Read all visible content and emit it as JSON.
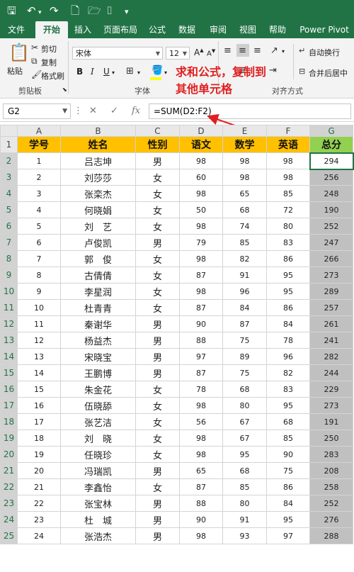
{
  "quick_access": {
    "save_icon": "save-icon",
    "undo_icon": "undo-icon",
    "redo_icon": "redo-icon",
    "new_icon": "new-file-icon",
    "open_icon": "open-folder-icon",
    "camera_icon": "camera-icon"
  },
  "tabs": [
    "文件",
    "开始",
    "插入",
    "页面布局",
    "公式",
    "数据",
    "审阅",
    "视图",
    "帮助",
    "Power Pivot"
  ],
  "active_tab": "开始",
  "clipboard": {
    "paste": "粘贴",
    "cut": "剪切",
    "copy": "复制",
    "format_painter": "格式刷",
    "group": "剪贴板"
  },
  "font": {
    "name": "宋体",
    "size": "12",
    "group": "字体",
    "bold": "B",
    "italic": "I",
    "underline": "U"
  },
  "alignment": {
    "wrap": "自动换行",
    "merge": "合并后居中",
    "group": "对齐方式"
  },
  "formula_bar": {
    "name_box": "G2",
    "formula": "=SUM(D2:F2)",
    "fx": "fx"
  },
  "annotation": {
    "line1": "求和公式，复制到",
    "line2": "其他单元格"
  },
  "columns": [
    "A",
    "B",
    "C",
    "D",
    "E",
    "F",
    "G"
  ],
  "headers": [
    "学号",
    "姓名",
    "性别",
    "语文",
    "数学",
    "英语",
    "总分"
  ],
  "rows": [
    [
      "1",
      "吕志坤",
      "男",
      "98",
      "98",
      "98",
      "294"
    ],
    [
      "2",
      "刘莎莎",
      "女",
      "60",
      "98",
      "98",
      "256"
    ],
    [
      "3",
      "张栾杰",
      "女",
      "98",
      "65",
      "85",
      "248"
    ],
    [
      "4",
      "何晓娟",
      "女",
      "50",
      "68",
      "72",
      "190"
    ],
    [
      "5",
      "刘　艺",
      "女",
      "98",
      "74",
      "80",
      "252"
    ],
    [
      "6",
      "卢俊凯",
      "男",
      "79",
      "85",
      "83",
      "247"
    ],
    [
      "7",
      "郭　俊",
      "女",
      "98",
      "82",
      "86",
      "266"
    ],
    [
      "8",
      "古倩倩",
      "女",
      "87",
      "91",
      "95",
      "273"
    ],
    [
      "9",
      "李星润",
      "女",
      "98",
      "96",
      "95",
      "289"
    ],
    [
      "10",
      "杜青青",
      "女",
      "87",
      "84",
      "86",
      "257"
    ],
    [
      "11",
      "秦谢华",
      "男",
      "90",
      "87",
      "84",
      "261"
    ],
    [
      "12",
      "杨益杰",
      "男",
      "88",
      "75",
      "78",
      "241"
    ],
    [
      "13",
      "宋晓宝",
      "男",
      "97",
      "89",
      "96",
      "282"
    ],
    [
      "14",
      "王鹏博",
      "男",
      "87",
      "75",
      "82",
      "244"
    ],
    [
      "15",
      "朱金花",
      "女",
      "78",
      "68",
      "83",
      "229"
    ],
    [
      "16",
      "伍晓舔",
      "女",
      "98",
      "80",
      "95",
      "273"
    ],
    [
      "17",
      "张艺洁",
      "女",
      "56",
      "67",
      "68",
      "191"
    ],
    [
      "18",
      "刘　晓",
      "女",
      "98",
      "67",
      "85",
      "250"
    ],
    [
      "19",
      "任晓珍",
      "女",
      "98",
      "95",
      "90",
      "283"
    ],
    [
      "20",
      "冯瑞凯",
      "男",
      "65",
      "68",
      "75",
      "208"
    ],
    [
      "21",
      "李鑫怡",
      "女",
      "87",
      "85",
      "86",
      "258"
    ],
    [
      "22",
      "张宝林",
      "男",
      "88",
      "80",
      "84",
      "252"
    ],
    [
      "23",
      "杜　城",
      "男",
      "90",
      "91",
      "95",
      "276"
    ],
    [
      "24",
      "张浩杰",
      "男",
      "98",
      "93",
      "97",
      "288"
    ]
  ]
}
